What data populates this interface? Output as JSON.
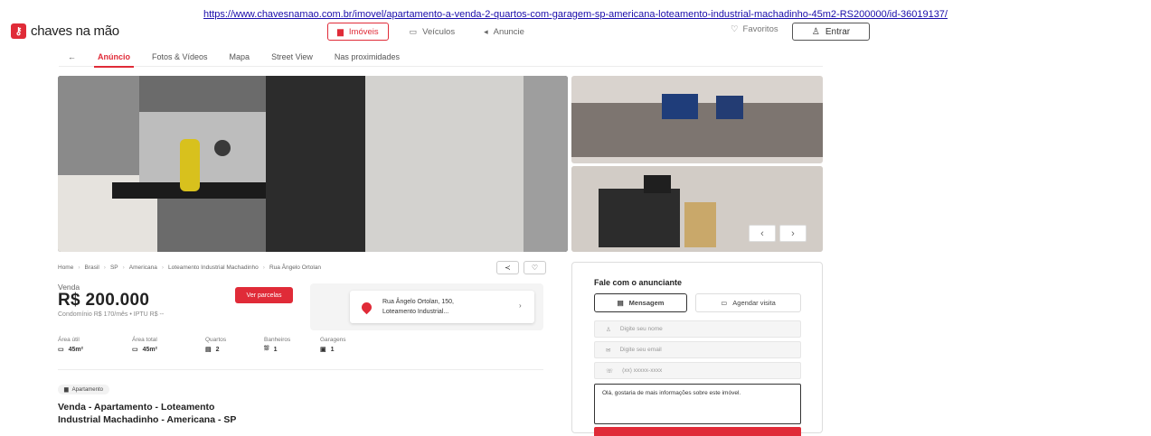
{
  "url": "https://www.chavesnamao.com.br/imovel/apartamento-a-venda-2-quartos-com-garagem-sp-americana-loteamento-industrial-machadinho-45m2-RS200000/id-36019137/",
  "header": {
    "logo_text": "chaves na mão",
    "nav": [
      {
        "label": "Imóveis",
        "icon": "buildings-icon"
      },
      {
        "label": "Veículos",
        "icon": "car-icon"
      },
      {
        "label": "Anuncie",
        "icon": "megaphone-icon"
      }
    ],
    "favorites": "Favoritos",
    "login": "Entrar"
  },
  "tabs": [
    "Anúncio",
    "Fotos & Vídeos",
    "Mapa",
    "Street View",
    "Nas proximidades"
  ],
  "breadcrumb": [
    "Home",
    "Brasil",
    "SP",
    "Americana",
    "Loteamento Industrial Machadinho",
    "Rua Ângelo Ortolan"
  ],
  "listing": {
    "sale_label": "Venda",
    "price": "R$ 200.000",
    "fees": "Condomínio R$ 170/mês  •  IPTU R$ --",
    "parcel_button": "Ver parcelas",
    "address_line1": "Rua Ângelo Ortolan, 150,",
    "address_line2": "Loteamento Industrial...",
    "specs": [
      {
        "label": "Área útil",
        "value": "45m²"
      },
      {
        "label": "Área total",
        "value": "45m²"
      },
      {
        "label": "Quartos",
        "value": "2"
      },
      {
        "label": "Banheiros",
        "value": "1"
      },
      {
        "label": "Garagens",
        "value": "1"
      }
    ],
    "type_badge": "Apartamento",
    "title_line1": "Venda - Apartamento - Loteamento",
    "title_line2": "Industrial Machadinho - Americana - SP"
  },
  "contact": {
    "title": "Fale com o anunciante",
    "tab_message": "Mensagem",
    "tab_visit": "Agendar visita",
    "name_placeholder": "Digite seu nome",
    "email_placeholder": "Digite seu email",
    "phone_placeholder": "(xx) xxxxx-xxxx",
    "message_text": "Olá, gostaria de mais informações sobre este imóvel."
  },
  "colors": {
    "brand": "#e02b38"
  }
}
